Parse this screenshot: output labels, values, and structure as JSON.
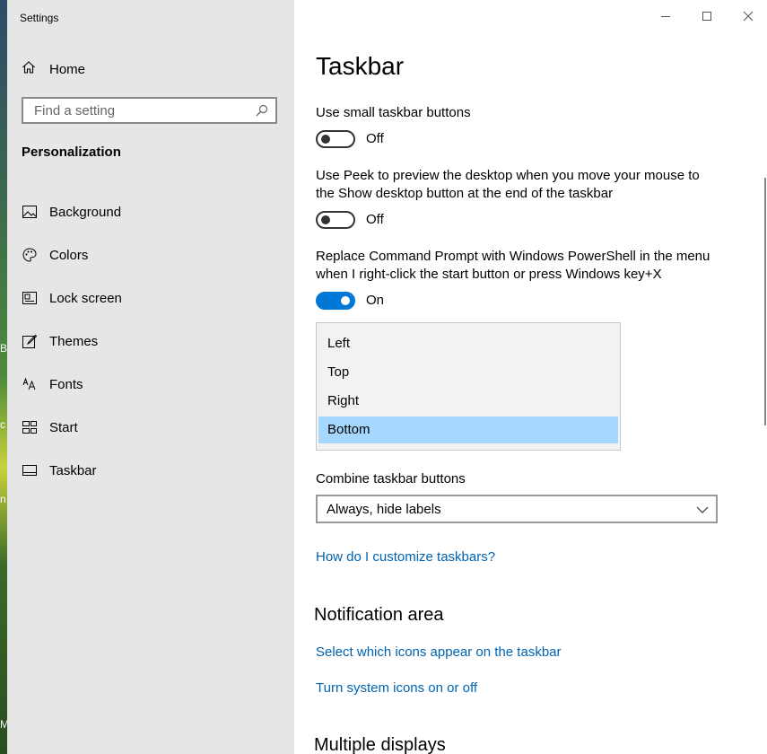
{
  "window": {
    "title": "Settings"
  },
  "sidebar": {
    "home_label": "Home",
    "search": {
      "placeholder": "Find a setting"
    },
    "section_title": "Personalization",
    "items": [
      {
        "label": "Background",
        "icon": "picture-icon"
      },
      {
        "label": "Colors",
        "icon": "palette-icon"
      },
      {
        "label": "Lock screen",
        "icon": "lock-screen-icon"
      },
      {
        "label": "Themes",
        "icon": "themes-brush-icon"
      },
      {
        "label": "Fonts",
        "icon": "fonts-icon"
      },
      {
        "label": "Start",
        "icon": "start-tiles-icon"
      },
      {
        "label": "Taskbar",
        "icon": "taskbar-icon",
        "selected": true
      }
    ]
  },
  "main": {
    "title": "Taskbar",
    "settings": [
      {
        "label": "Use small taskbar buttons",
        "state": "Off"
      },
      {
        "label": "Use Peek to preview the desktop when you move your mouse to the Show desktop button at the end of the taskbar",
        "state": "Off"
      },
      {
        "label": "Replace Command Prompt with Windows PowerShell in the menu when I right-click the start button or press Windows key+X",
        "state": "On"
      }
    ],
    "location_dropdown": {
      "options": [
        "Left",
        "Top",
        "Right",
        "Bottom"
      ],
      "selected": "Bottom"
    },
    "combine": {
      "label": "Combine taskbar buttons",
      "value": "Always, hide labels"
    },
    "help_link": "How do I customize taskbars?",
    "notification_area": {
      "heading": "Notification area",
      "links": [
        "Select which icons appear on the taskbar",
        "Turn system icons on or off"
      ]
    },
    "multiple_displays": {
      "heading": "Multiple displays"
    }
  },
  "desktop": {
    "fragments": [
      "B",
      "c",
      "n",
      "M"
    ]
  },
  "colors": {
    "accent": "#0078d7",
    "link": "#0063b1",
    "selection": "#a6d8ff",
    "sidebar_bg": "#e6e6e6"
  }
}
